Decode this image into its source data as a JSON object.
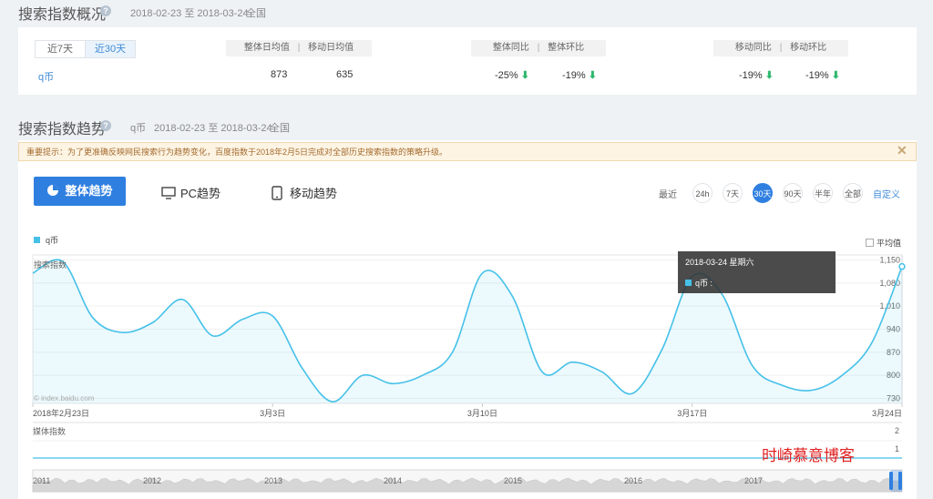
{
  "overview": {
    "title": "搜索指数概况",
    "date_range": "2018-02-23 至 2018-03-24",
    "region": "全国",
    "seg_7": "近7天",
    "seg_30": "近30天",
    "head_avg": "整体日均值",
    "head_mobile_avg": "移动日均值",
    "head_yoy": "整体同比",
    "head_mom": "整体环比",
    "head_m_yoy": "移动同比",
    "head_m_mom": "移动环比",
    "sep": "|",
    "keyword": "q币",
    "avg": "873",
    "mobile_avg": "635",
    "yoy": "-25%",
    "mom": "-19%",
    "m_yoy": "-19%",
    "m_mom": "-19%",
    "arrow": "⬇"
  },
  "trend": {
    "title": "搜索指数趋势",
    "keyword": "q币",
    "date_range": "2018-02-23 至 2018-03-24",
    "region": "全国",
    "notice": "重要提示：为了更准确反映网民搜索行为趋势变化，百度指数于2018年2月5日完成对全部历史搜索指数的策略升级。",
    "tab_all": "整体趋势",
    "tab_pc": "PC趋势",
    "tab_mobile": "移动趋势",
    "recent_label": "最近",
    "ranges": [
      "24h",
      "7天",
      "30天",
      "90天",
      "半年",
      "全部"
    ],
    "custom": "自定义",
    "avg_label": "平均值",
    "search_index_label": "搜索指数",
    "media_index_label": "媒体指数",
    "watermark": "© index.baidu.com",
    "tooltip_date": "2018-03-24 星期六",
    "tooltip_series": "q币 :",
    "blog_watermark": "时崎慕意博客",
    "media_ticks": [
      "2",
      "1"
    ],
    "timeline_years": [
      "2011",
      "2012",
      "2013",
      "2014",
      "2015",
      "2016",
      "2017"
    ]
  },
  "chart_data": {
    "type": "area",
    "series": [
      {
        "name": "q币"
      }
    ],
    "x": [
      "2018-02-23",
      "2018-02-24",
      "2018-02-25",
      "2018-02-26",
      "2018-02-27",
      "2018-02-28",
      "2018-03-01",
      "2018-03-02",
      "2018-03-03",
      "2018-03-04",
      "2018-03-05",
      "2018-03-06",
      "2018-03-07",
      "2018-03-08",
      "2018-03-09",
      "2018-03-10",
      "2018-03-11",
      "2018-03-12",
      "2018-03-13",
      "2018-03-14",
      "2018-03-15",
      "2018-03-16",
      "2018-03-17",
      "2018-03-18",
      "2018-03-19",
      "2018-03-20",
      "2018-03-21",
      "2018-03-22",
      "2018-03-23",
      "2018-03-24"
    ],
    "values": [
      1110,
      1145,
      975,
      930,
      960,
      1030,
      920,
      970,
      980,
      820,
      720,
      800,
      775,
      800,
      870,
      1110,
      1040,
      810,
      840,
      810,
      745,
      880,
      1100,
      1045,
      830,
      770,
      755,
      800,
      900,
      1130
    ],
    "x_tick_labels": [
      "2018年2月23日",
      "3月3日",
      "3月10日",
      "3月17日",
      "3月24日"
    ],
    "y_tick_labels": [
      "1,150",
      "1,080",
      "1,010",
      "940",
      "870",
      "800",
      "730"
    ],
    "ylim": [
      715,
      1165
    ],
    "grid": true,
    "color": "#45c1e8"
  }
}
